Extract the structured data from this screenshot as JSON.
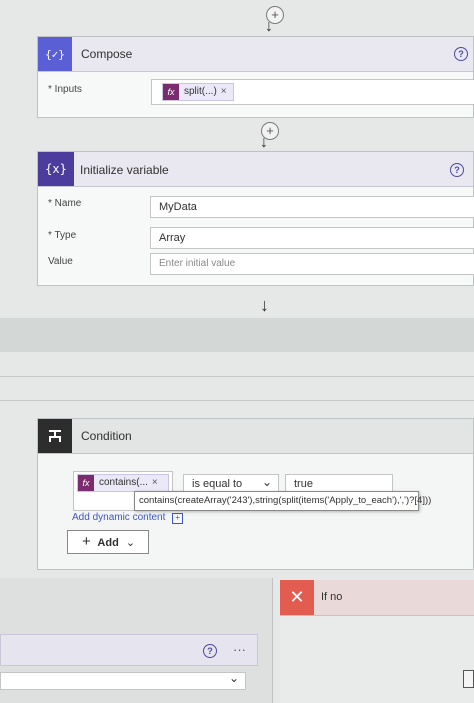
{
  "compose": {
    "title": "Compose",
    "icon_text": "{✓}",
    "inputs_label": "* Inputs",
    "token_fx": "fx",
    "token_text": "split(...)",
    "token_close": "×"
  },
  "init_var": {
    "title": "Initialize variable",
    "icon_text": "{x}",
    "name_label": "* Name",
    "name_value": "MyData",
    "type_label": "* Type",
    "type_value": "Array",
    "value_label": "Value",
    "value_placeholder": "Enter initial value"
  },
  "condition": {
    "title": "Condition",
    "token_fx": "fx",
    "token_text": "contains(...",
    "token_close": "×",
    "operator": "is equal to",
    "right_value": "true",
    "tooltip": "contains(createArray('243'),string(split(items('Apply_to_each'),',')?[4]))",
    "add_dynamic": "Add dynamic content",
    "add_button": "Add"
  },
  "if_no": {
    "title": "If no",
    "icon_text": "✕"
  },
  "glyphs": {
    "help": "?",
    "plus": "+",
    "down_arrow": "↓",
    "more": "···",
    "chevron": "⌄"
  },
  "colors": {
    "compose_icon": "#5a5fd6",
    "variable_icon": "#4b3c9e",
    "condition_icon": "#2d2d2d",
    "if_no_icon": "#e25c50",
    "header_bg": "#e9e7f0"
  }
}
